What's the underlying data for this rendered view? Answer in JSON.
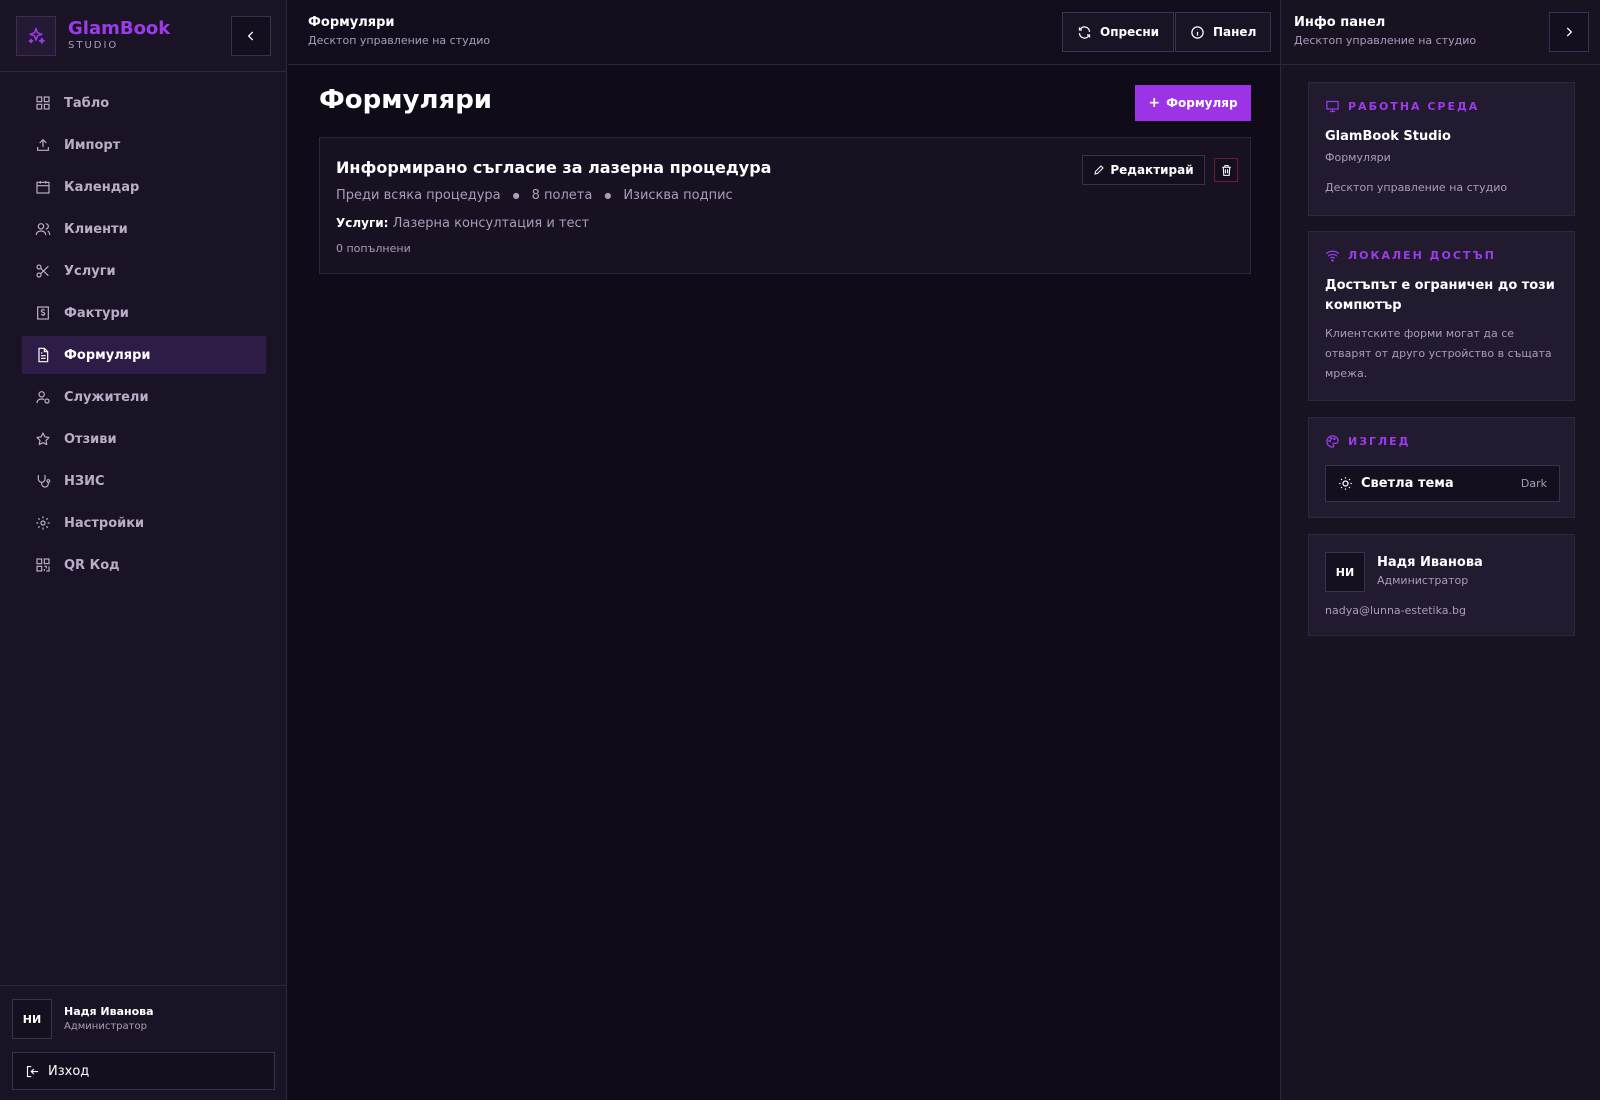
{
  "colors": {
    "accent": "#9d33e6",
    "background": "#0f0b18",
    "sidebar": "#1a1325",
    "danger": "#e2334a"
  },
  "brand": {
    "name": "GlamBook",
    "sub": "STUDIO",
    "logo_icon": "sparkles-icon"
  },
  "sidebar": {
    "items": [
      {
        "label": "Табло",
        "icon": "dashboard-icon",
        "active": false
      },
      {
        "label": "Импорт",
        "icon": "upload-icon",
        "active": false
      },
      {
        "label": "Календар",
        "icon": "calendar-icon",
        "active": false
      },
      {
        "label": "Клиенти",
        "icon": "users-icon",
        "active": false
      },
      {
        "label": "Услуги",
        "icon": "scissors-icon",
        "active": false
      },
      {
        "label": "Фактури",
        "icon": "invoice-icon",
        "active": false
      },
      {
        "label": "Формуляри",
        "icon": "document-icon",
        "active": true
      },
      {
        "label": "Служители",
        "icon": "staff-icon",
        "active": false
      },
      {
        "label": "Отзиви",
        "icon": "star-icon",
        "active": false
      },
      {
        "label": "НЗИС",
        "icon": "stethoscope-icon",
        "active": false
      },
      {
        "label": "Настройки",
        "icon": "gear-icon",
        "active": false
      },
      {
        "label": "QR Код",
        "icon": "qr-code-icon",
        "active": false
      }
    ],
    "user": {
      "initials": "НИ",
      "name": "Надя Иванова",
      "role": "Администратор"
    },
    "logout_label": "Изход"
  },
  "topbar": {
    "title": "Формуляри",
    "subtitle": "Десктоп управление на студио",
    "refresh_label": "Опресни",
    "panel_label": "Панел"
  },
  "main": {
    "title": "Формуляри",
    "add_label": "Формуляр",
    "forms": [
      {
        "title": "Информирано съгласие за лазерна процедура",
        "timing": "Преди всяка процедура",
        "fields": "8 полета",
        "signature": "Изисква подпис",
        "services_label": "Услуги:",
        "services": "Лазерна консултация и тест",
        "filled": "0 попълнени",
        "edit_label": "Редактирай"
      }
    ]
  },
  "rpanel": {
    "title": "Инфо панел",
    "subtitle": "Десктоп управление на студио",
    "workspace": {
      "label": "РАБОТНА СРЕДА",
      "name": "GlamBook Studio",
      "page": "Формуляри",
      "desc": "Десктоп управление на студио"
    },
    "local": {
      "label": "ЛОКАЛЕН ДОСТЪП",
      "heading": "Достъпът е ограничен до този компютър",
      "text": "Клиентските форми могат да се отварят от друго устройство в същата мрежа."
    },
    "appearance": {
      "label": "ИЗГЛЕД",
      "theme_label": "Светла тема",
      "theme_value": "Dark"
    },
    "user": {
      "initials": "НИ",
      "name": "Надя Иванова",
      "role": "Администратор",
      "email": "nadya@lunna-estetika.bg"
    }
  }
}
